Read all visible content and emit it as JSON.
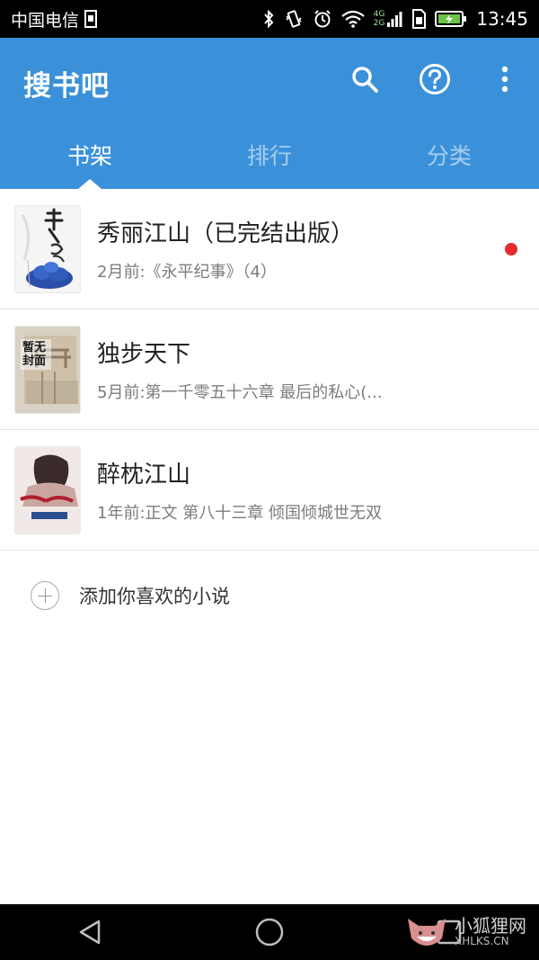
{
  "status_bar": {
    "carrier": "中国电信",
    "network_type": "4G\n2G",
    "time": "13:45"
  },
  "app": {
    "title": "搜书吧",
    "actions": {
      "search": "search-icon",
      "help": "help-icon",
      "more": "more-vert-icon"
    },
    "tabs": [
      {
        "label": "书架",
        "active": true
      },
      {
        "label": "排行",
        "active": false
      },
      {
        "label": "分类",
        "active": false
      }
    ],
    "accent_color": "#3b91d9"
  },
  "books": [
    {
      "title": "秀丽江山（已完结出版）",
      "subtitle": "2月前:《永平纪事》（4）",
      "unread": true
    },
    {
      "title": "独步天下",
      "subtitle": "5月前:第一千零五十六章 最后的私心(...",
      "unread": false,
      "cover_text": "暂无封面"
    },
    {
      "title": "醉枕江山",
      "subtitle": "1年前:正文 第八十三章 倾国倾城世无双",
      "unread": false
    }
  ],
  "add_book": {
    "label": "添加你喜欢的小说"
  },
  "watermark": {
    "text": "小狐狸网",
    "url": "XHLKS.CN"
  }
}
